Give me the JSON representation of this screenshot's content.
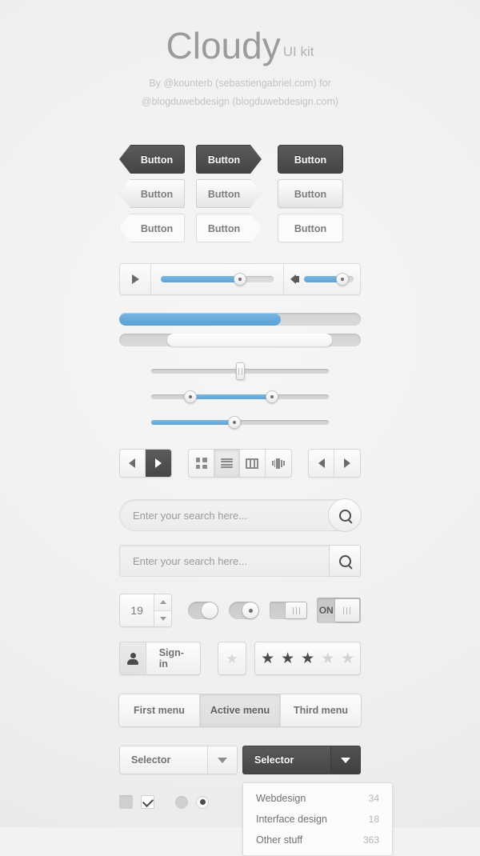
{
  "header": {
    "title": "Cloudy",
    "subtitle": "UI kit",
    "credit_line1": "By @kounterb (sebastiengabriel.com) for",
    "credit_line2": "@blogduwebdesign (blogduwebdesign.com)"
  },
  "colors": {
    "accent_blue": "#5fa3d6",
    "dark_button": "#4a4a4a",
    "page_background": "#f1f1f1",
    "text_gray": "#6f6f6f",
    "muted_gray": "#b4b4b4"
  },
  "buttons": {
    "label": "Button",
    "rows": [
      {
        "style": "dark",
        "items": [
          "Button",
          "Button",
          "Button"
        ]
      },
      {
        "style": "gradient",
        "items": [
          "Button",
          "Button",
          "Button"
        ]
      },
      {
        "style": "flat",
        "items": [
          "Button",
          "Button",
          "Button"
        ]
      }
    ]
  },
  "player": {
    "play_icon": "play-icon",
    "progress_percent": 70,
    "volume_icon": "speaker-icon",
    "volume_percent": 78
  },
  "progress_bars": [
    {
      "name": "blue-progress",
      "percent": 67
    },
    {
      "name": "scroll-thumb",
      "start_percent": 20,
      "end_percent": 88
    }
  ],
  "sliders": [
    {
      "name": "single-center-handle",
      "type": "vertical-handle",
      "value_percent": 50
    },
    {
      "name": "range-slider",
      "type": "range",
      "start_percent": 22,
      "end_percent": 68
    },
    {
      "name": "value-slider",
      "type": "single",
      "value_percent": 47
    }
  ],
  "toolbar": {
    "nav_left": {
      "prev_icon": "triangle-left-icon",
      "next_icon": "triangle-right-icon",
      "active_index": 1
    },
    "view_modes": [
      {
        "icon": "grid-view-icon",
        "active": false
      },
      {
        "icon": "list-view-icon",
        "active": true
      },
      {
        "icon": "column-view-icon",
        "active": false
      },
      {
        "icon": "coverflow-view-icon",
        "active": false
      }
    ],
    "nav_right": {
      "prev_icon": "triangle-left-icon",
      "next_icon": "triangle-right-icon"
    }
  },
  "search": {
    "placeholder": "Enter your search here...",
    "value": "",
    "button_icon": "search-icon"
  },
  "stepper": {
    "value": "19",
    "up_icon": "caret-up-icon",
    "down_icon": "caret-down-icon"
  },
  "toggles": [
    {
      "name": "toggle-pill-plain",
      "state": "on",
      "label": ""
    },
    {
      "name": "toggle-pill-dot",
      "state": "on",
      "label": ""
    },
    {
      "name": "toggle-square-grip",
      "state": "on",
      "label": ""
    },
    {
      "name": "toggle-on-label",
      "state": "on",
      "label": "ON"
    }
  ],
  "signin": {
    "label": "Sign-in",
    "icon": "person-icon"
  },
  "rating": {
    "single_star_icon": "star-icon",
    "total": 5,
    "filled": 3
  },
  "tabs": [
    {
      "label": "First menu",
      "active": false
    },
    {
      "label": "Active menu",
      "active": true
    },
    {
      "label": "Third menu",
      "active": false
    }
  ],
  "selectors": [
    {
      "name": "selector-light",
      "label": "Selector",
      "style": "light",
      "open": false
    },
    {
      "name": "selector-dark",
      "label": "Selector",
      "style": "dark",
      "open": true
    }
  ],
  "dropdown": {
    "items": [
      {
        "label": "Webdesign",
        "count": "34"
      },
      {
        "label": "Interface design",
        "count": "18"
      },
      {
        "label": "Other stuff",
        "count": "363"
      }
    ]
  },
  "checks": [
    {
      "name": "checkbox-unchecked",
      "type": "checkbox",
      "checked": false
    },
    {
      "name": "checkbox-checked",
      "type": "checkbox",
      "checked": true
    },
    {
      "name": "radio-unchecked",
      "type": "radio",
      "checked": false
    },
    {
      "name": "radio-checked",
      "type": "radio",
      "checked": true
    }
  ]
}
